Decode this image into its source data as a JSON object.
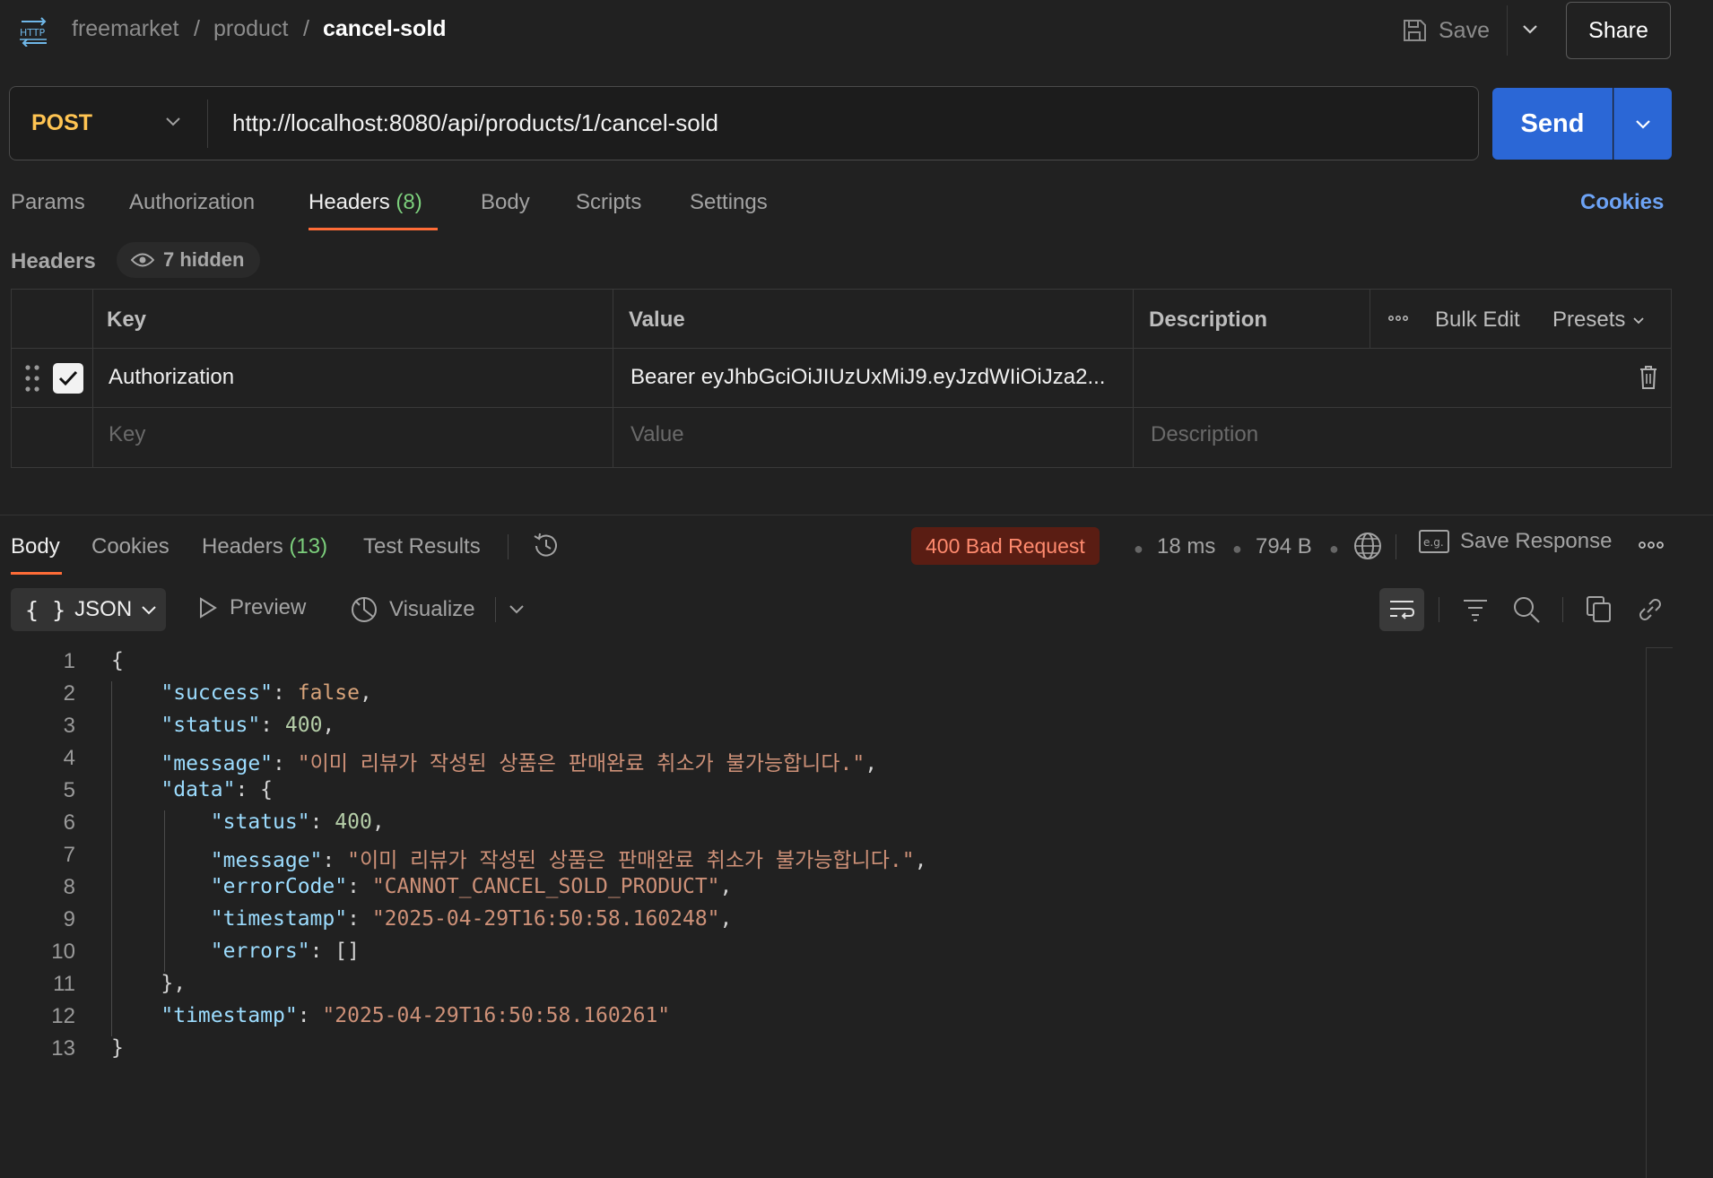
{
  "breadcrumb": {
    "workspace": "freemarket",
    "collection": "product",
    "request": "cancel-sold",
    "separator": "/"
  },
  "topbar": {
    "save_label": "Save",
    "share_label": "Share"
  },
  "request": {
    "method": "POST",
    "url": "http://localhost:8080/api/products/1/cancel-sold",
    "send_label": "Send",
    "method_color": "#ffc452"
  },
  "request_tabs": {
    "params": "Params",
    "authorization": "Authorization",
    "headers": "Headers",
    "headers_count": "(8)",
    "body": "Body",
    "scripts": "Scripts",
    "settings": "Settings",
    "cookies": "Cookies"
  },
  "headers_section": {
    "label": "Headers",
    "hidden_label": "7 hidden",
    "columns": {
      "key": "Key",
      "value": "Value",
      "description": "Description"
    },
    "bulk_edit": "Bulk Edit",
    "presets": "Presets",
    "rows": [
      {
        "key": "Authorization",
        "value": "Bearer eyJhbGciOiJIUzUxMiJ9.eyJzdWIiOiJza2...",
        "description": "",
        "enabled": true
      }
    ],
    "placeholders": {
      "key": "Key",
      "value": "Value",
      "description": "Description"
    }
  },
  "response_tabs": {
    "body": "Body",
    "cookies": "Cookies",
    "headers": "Headers",
    "headers_count": "(13)",
    "test_results": "Test Results"
  },
  "response_meta": {
    "status": "400 Bad Request",
    "time": "18 ms",
    "size": "794 B",
    "save_response": "Save Response",
    "status_color": "#ff8a6e"
  },
  "body_toolbar": {
    "format": "JSON",
    "preview": "Preview",
    "visualize": "Visualize"
  },
  "code_lines": [
    "{",
    "    \"success\": false,",
    "    \"status\": 400,",
    "    \"message\": \"이미 리뷰가 작성된 상품은 판매완료 취소가 불가능합니다.\",",
    "    \"data\": {",
    "        \"status\": 400,",
    "        \"message\": \"이미 리뷰가 작성된 상품은 판매완료 취소가 불가능합니다.\",",
    "        \"errorCode\": \"CANNOT_CANCEL_SOLD_PRODUCT\",",
    "        \"timestamp\": \"2025-04-29T16:50:58.160248\",",
    "        \"errors\": []",
    "    },",
    "    \"timestamp\": \"2025-04-29T16:50:58.160261\"",
    "}"
  ]
}
